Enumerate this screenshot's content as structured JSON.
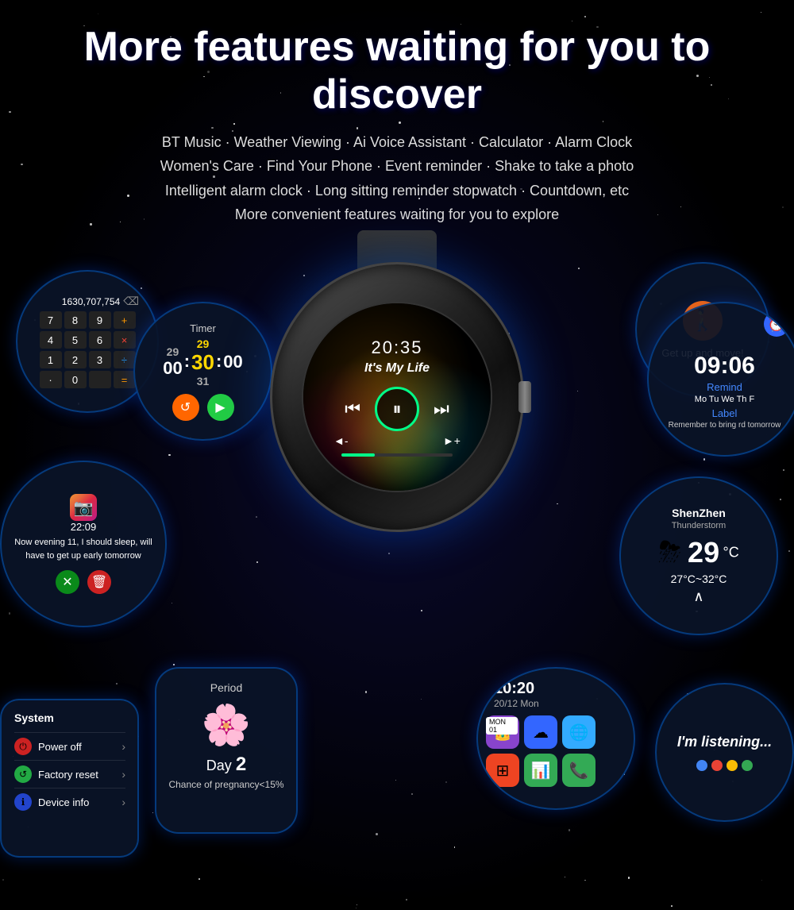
{
  "page": {
    "title": "More features waiting for you to discover",
    "subtitle_lines": [
      "BT Music · Weather Viewing · Ai Voice Assistant · Calculator · Alarm Clock",
      "Women's Care · Find Your Phone · Event reminder · Shake to take a photo",
      "Intelligent alarm clock · Long sitting reminder stopwatch · Countdown, etc",
      "More convenient features waiting for you to explore"
    ]
  },
  "watch": {
    "time": "20:35",
    "song": "It's My Life",
    "controls": {
      "prev": "⏮",
      "play_pause": "⏸",
      "next": "⏭",
      "vol_down": "◄-",
      "vol_up": "►+"
    }
  },
  "bubbles": {
    "calculator": {
      "display": "1630,707,754",
      "buttons": [
        [
          "7",
          "8",
          "9",
          "+"
        ],
        [
          "4",
          "5",
          "6",
          "×"
        ],
        [
          "1",
          "2",
          "3",
          "÷"
        ],
        [
          "",
          "0",
          "",
          "="
        ]
      ]
    },
    "timer": {
      "title": "Timer",
      "prev_num": "29",
      "main_num": "30",
      "next_num": "31",
      "format": "00 : 30 : 00"
    },
    "activity": {
      "text": "Get up and move!"
    },
    "alarm": {
      "time": "09:06",
      "remind": "Remind",
      "days": "Mo Tu We Th F",
      "label": "Label",
      "note": "Remember to bring rd tomorrow"
    },
    "weather": {
      "city": "ShenZhen",
      "condition": "Thunderstorm",
      "temp": "29",
      "unit": "°C",
      "range": "27°C~32°C"
    },
    "notification": {
      "time": "22:09",
      "text": "Now evening 11, I should sleep, will have to get up early tomorrow"
    },
    "period": {
      "title": "Period",
      "day_label": "Day",
      "day_num": "2",
      "info": "Chance of pregnancy<15%"
    },
    "system": {
      "title": "System",
      "items": [
        {
          "icon": "⏻",
          "color": "red",
          "label": "Power off"
        },
        {
          "icon": "↺",
          "color": "green",
          "label": "Factory reset"
        },
        {
          "icon": "ℹ",
          "color": "blue",
          "label": "Device info"
        }
      ]
    },
    "voice": {
      "text": "I'm listening...",
      "dots": [
        "#4285f4",
        "#ea4335",
        "#fbbc04",
        "#34a853"
      ]
    },
    "smart": {
      "time": "10:20",
      "date": "20/12  Mon"
    }
  }
}
